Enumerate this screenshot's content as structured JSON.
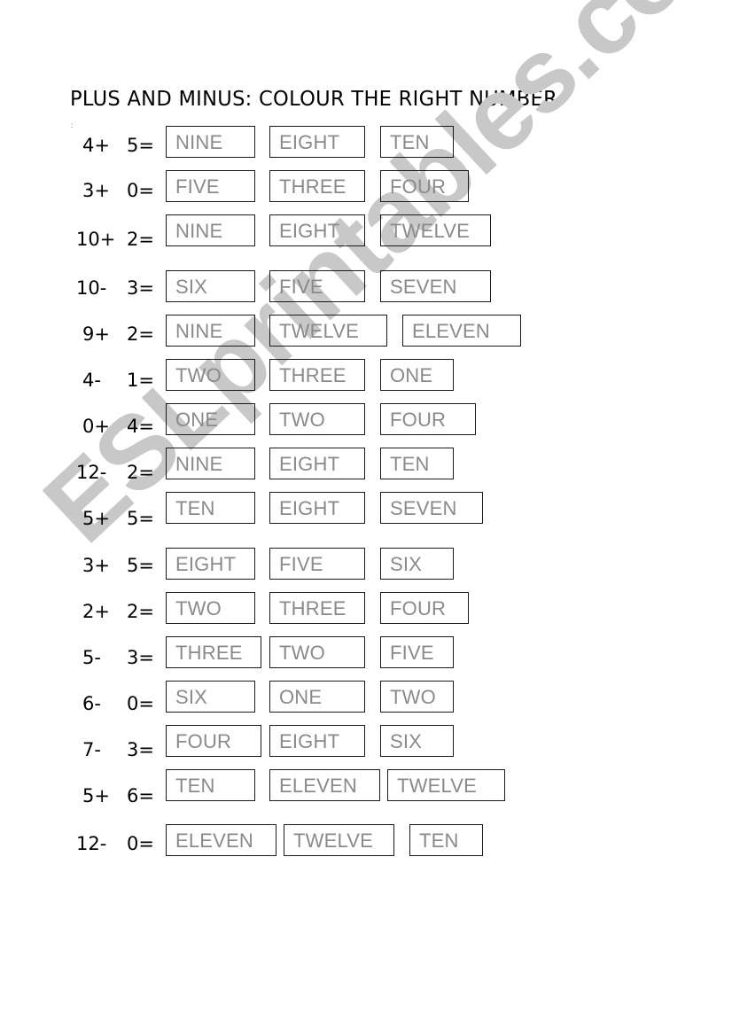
{
  "title": "PLUS AND MINUS: COLOUR THE RIGHT NUMBER.",
  "stray_mark": ":",
  "watermark": "ESLprintables.com",
  "colors": {
    "text": "#000000",
    "option_text": "#8a8a8a",
    "box_border": "#1a1a1a",
    "watermark": "#c8c8c8"
  },
  "exercises": [
    {
      "left": "4+",
      "right": "5=",
      "options": [
        "NINE",
        "EIGHT",
        "TEN"
      ]
    },
    {
      "left": "3+",
      "right": "0=",
      "options": [
        "FIVE",
        "THREE",
        "FOUR"
      ]
    },
    {
      "left": "10+",
      "right": "2=",
      "options": [
        "NINE",
        "EIGHT",
        "TWELVE"
      ]
    },
    {
      "left": "10-",
      "right": "3=",
      "options": [
        "SIX",
        "FIVE",
        "SEVEN"
      ]
    },
    {
      "left": "9+",
      "right": "2=",
      "options": [
        "NINE",
        "TWELVE",
        "ELEVEN"
      ]
    },
    {
      "left": "4-",
      "right": "1=",
      "options": [
        "TWO",
        "THREE",
        "ONE"
      ]
    },
    {
      "left": "0+",
      "right": "4=",
      "options": [
        "ONE",
        "TWO",
        "FOUR"
      ]
    },
    {
      "left": "12-",
      "right": "2=",
      "options": [
        "NINE",
        "EIGHT",
        "TEN"
      ]
    },
    {
      "left": "5+",
      "right": "5=",
      "options": [
        "TEN",
        "EIGHT",
        "SEVEN"
      ]
    },
    {
      "left": "3+",
      "right": "5=",
      "options": [
        "EIGHT",
        "FIVE",
        "SIX"
      ]
    },
    {
      "left": "2+",
      "right": "2=",
      "options": [
        "TWO",
        "THREE",
        "FOUR"
      ]
    },
    {
      "left": "5-",
      "right": "3=",
      "options": [
        "THREE",
        "TWO",
        "FIVE"
      ]
    },
    {
      "left": "6-",
      "right": "0=",
      "options": [
        "SIX",
        "ONE",
        "TWO"
      ]
    },
    {
      "left": "7-",
      "right": "3=",
      "options": [
        "FOUR",
        "EIGHT",
        "SIX"
      ]
    },
    {
      "left": "5+",
      "right": "6=",
      "options": [
        "TEN",
        "ELEVEN",
        "TWELVE"
      ]
    },
    {
      "left": "12-",
      "right": "0=",
      "options": [
        "ELEVEN",
        "TWELVE",
        "TEN"
      ]
    }
  ]
}
